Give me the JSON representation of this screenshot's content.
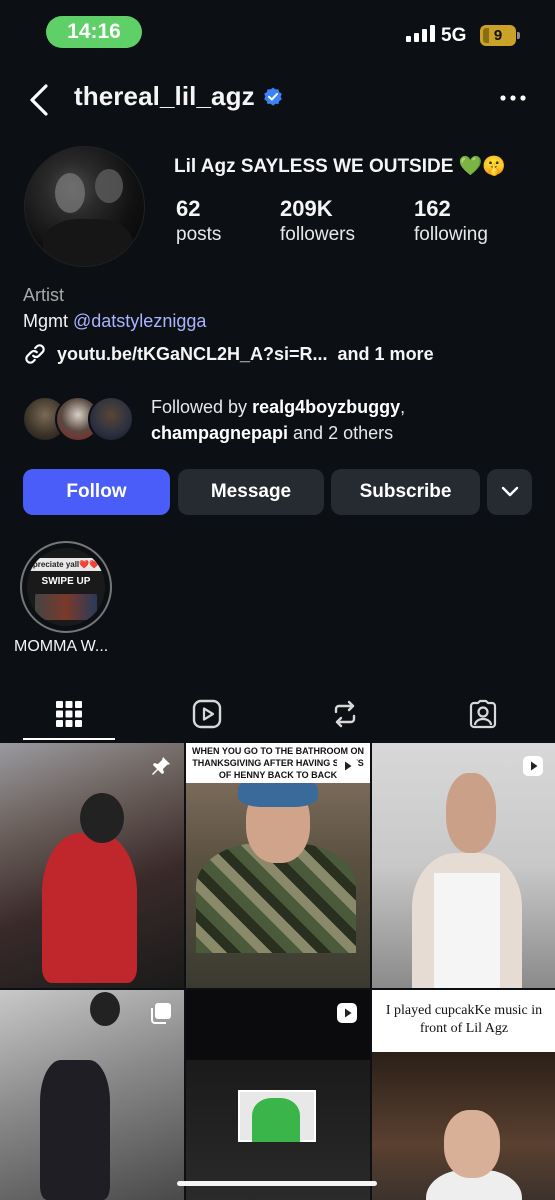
{
  "status_bar": {
    "time": "14:16",
    "network": "5G",
    "battery": "9"
  },
  "header": {
    "username": "thereal_lil_agz",
    "verified": true
  },
  "profile": {
    "display_name": "Lil Agz SAYLESS WE OUTSIDE 💚🤫",
    "stats": [
      {
        "value": "62",
        "label": "posts"
      },
      {
        "value": "209K",
        "label": "followers"
      },
      {
        "value": "162",
        "label": "following"
      }
    ],
    "category": "Artist",
    "bio_prefix": "Mgmt ",
    "bio_mention": "@datstyleznigga",
    "link_text": "youtu.be/tKGaNCL2H_A?si=R...",
    "link_more": "and 1 more",
    "followed_by": {
      "prefix": "Followed by ",
      "user1": "realg4boyzbuggy",
      "sep": ",",
      "user2": "champagnepapi",
      "suffix": " and 2 others"
    }
  },
  "actions": {
    "follow": "Follow",
    "message": "Message",
    "subscribe": "Subscribe"
  },
  "highlights": [
    {
      "label": "MOMMA W...",
      "thumb_top": "preciate yall❤️❤️",
      "thumb_mid": "SWIPE UP"
    }
  ],
  "tabs": [
    "grid-icon",
    "reels-icon",
    "reposts-icon",
    "tagged-icon"
  ],
  "grid": {
    "captions": {
      "post2": "WHEN YOU GO TO THE BATHROOM ON THANKSGIVING AFTER HAVING SHOTS OF HENNY BACK TO BACK",
      "post6": "I played cupcakKe music in front of Lil Agz"
    }
  },
  "colors": {
    "accent": "#4a5df9",
    "background": "#0c0f14",
    "button": "#262a31",
    "verified": "#3b82f6",
    "time_pill": "#5fd068"
  }
}
